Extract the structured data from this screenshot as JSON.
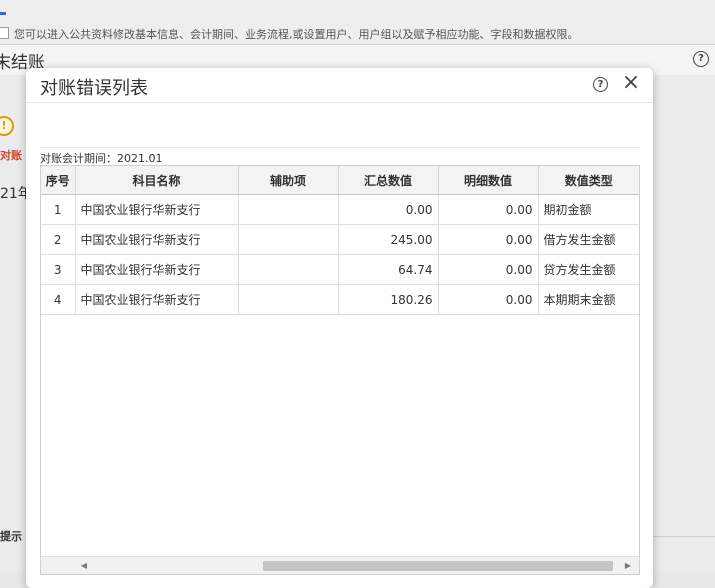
{
  "background": {
    "notice": "您可以进入公共资料修改基本信息、会计期间、业务流程,或设置用户、用户组以及赋予相应功能、字段和数据权限。",
    "page_title": "末结账",
    "warn_label": "!",
    "red_text": "对账",
    "year_text": "21年",
    "hint_text": "提示",
    "help_icon": "question-circle-icon"
  },
  "modal": {
    "title": "对账错误列表",
    "help_glyph": "?",
    "close_glyph": "×",
    "period_label": "对账会计期间：",
    "period_value": "2021.01",
    "columns": [
      "序号",
      "科目名称",
      "辅助项",
      "汇总数值",
      "明细数值",
      "数值类型"
    ],
    "rows": [
      {
        "index": "1",
        "account": "中国农业银行华新支行",
        "aux": "",
        "summary": "0.00",
        "detail": "0.00",
        "type": "期初金额"
      },
      {
        "index": "2",
        "account": "中国农业银行华新支行",
        "aux": "",
        "summary": "245.00",
        "detail": "0.00",
        "type": "借方发生金额"
      },
      {
        "index": "3",
        "account": "中国农业银行华新支行",
        "aux": "",
        "summary": "64.74",
        "detail": "0.00",
        "type": "贷方发生金额"
      },
      {
        "index": "4",
        "account": "中国农业银行华新支行",
        "aux": "",
        "summary": "180.26",
        "detail": "0.00",
        "type": "本期期末金额"
      }
    ],
    "scroll_left": "◀",
    "scroll_right": "▶"
  }
}
